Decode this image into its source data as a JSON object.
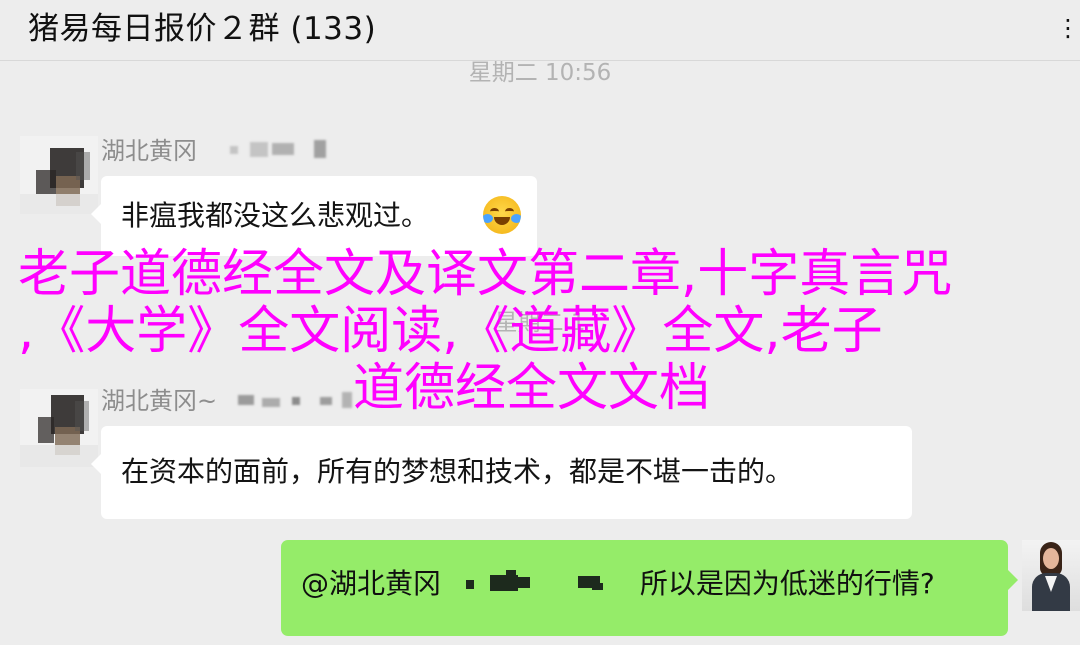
{
  "header": {
    "title": "猪易每日报价２群 (133)",
    "more_icon": "more-icon"
  },
  "messages": {
    "timestamp_1": "星期二 10:56",
    "timestamp_2": "星期二 1",
    "message_1": {
      "sender": "湖北黄冈",
      "text": "非瘟我都没这么悲观过。",
      "emoji": "crying-laughing-icon"
    },
    "message_2": {
      "sender": "湖北黄冈~",
      "text": "在资本的面前，所有的梦想和技术，都是不堪一击的。"
    },
    "message_3": {
      "mention": "@湖北黄冈",
      "text": "所以是因为低迷的行情?"
    }
  },
  "overlay": {
    "line_1": "老子道德经全文及译文第二章,十字真言咒",
    "line_2": ",《大学》全文阅读,《道藏》全文,老子",
    "line_3": "道德经全文文档",
    "color": "#ff00ff"
  }
}
